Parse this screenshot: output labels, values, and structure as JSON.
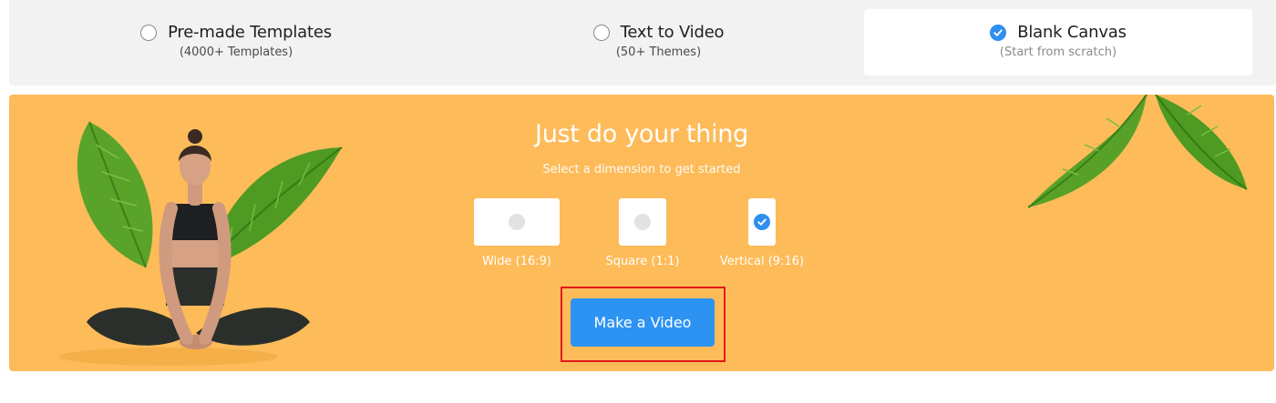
{
  "tabs": [
    {
      "title": "Pre-made Templates",
      "subtitle": "(4000+ Templates)",
      "selected": false
    },
    {
      "title": "Text to Video",
      "subtitle": "(50+ Themes)",
      "selected": false
    },
    {
      "title": "Blank Canvas",
      "subtitle": "(Start from scratch)",
      "selected": true
    }
  ],
  "banner": {
    "headline": "Just do your thing",
    "subline": "Select a dimension to get started",
    "dimensions": [
      {
        "label": "Wide (16:9)",
        "selected": false
      },
      {
        "label": "Square (1:1)",
        "selected": false
      },
      {
        "label": "Vertical (9:16)",
        "selected": true
      }
    ],
    "cta_label": "Make a Video",
    "background_color": "#fdbb59",
    "accent_color": "#2d93f3",
    "highlight_color": "#e01b1b"
  },
  "icons": {
    "unselected": "radio-icon",
    "selected": "check-circle-icon"
  }
}
